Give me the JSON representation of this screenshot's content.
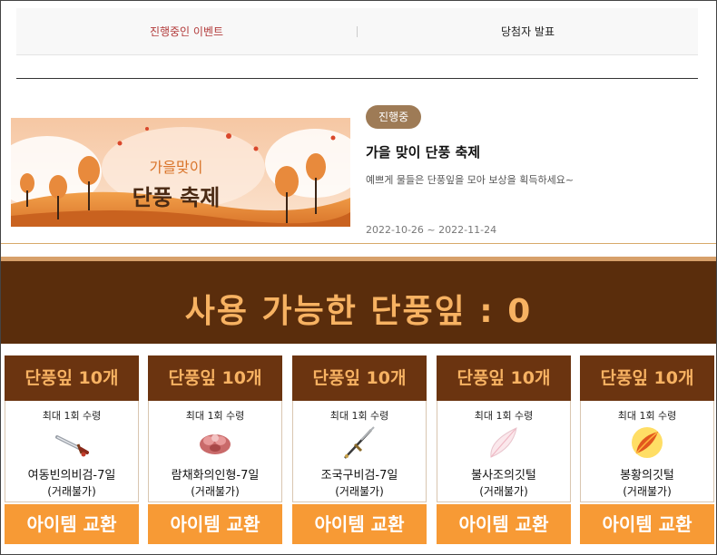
{
  "tabs": [
    {
      "label": "진행중인 이벤트"
    },
    {
      "label": "당첨자 발표"
    }
  ],
  "event": {
    "status": "진행중",
    "title": "가을 맞이 단풍 축제",
    "description": "예쁘게 물들은 단풍잎을 모아 보상을 획득하세요~",
    "period": "2022-10-26 ~ 2022-11-24",
    "banner": {
      "line1": "가을맞이",
      "line2": "단풍 축제"
    }
  },
  "available": {
    "text": "사용 가능한 단풍잎 : 0"
  },
  "cards": [
    {
      "cost": "단풍잎 10개",
      "limit": "최대 1회 수령",
      "name": "여동빈의비검-7일",
      "sub": "(거래불가)",
      "button": "아이템 교환",
      "icon": "sword-icon"
    },
    {
      "cost": "단풍잎 10개",
      "limit": "최대 1회 수령",
      "name": "람채화의인형-7일",
      "sub": "(거래불가)",
      "button": "아이템 교환",
      "icon": "doll-icon"
    },
    {
      "cost": "단풍잎 10개",
      "limit": "최대 1회 수령",
      "name": "조국구비검-7일",
      "sub": "(거래불가)",
      "button": "아이템 교환",
      "icon": "dagger-icon"
    },
    {
      "cost": "단풍잎 10개",
      "limit": "최대 1회 수령",
      "name": "불사조의깃털",
      "sub": "(거래불가)",
      "button": "아이템 교환",
      "icon": "white-feather-icon"
    },
    {
      "cost": "단풍잎 10개",
      "limit": "최대 1회 수령",
      "name": "봉황의깃털",
      "sub": "(거래불가)",
      "button": "아이템 교환",
      "icon": "fire-feather-icon"
    }
  ],
  "colors": {
    "active_tab": "#b23a3a",
    "brown": "#5a2d0c",
    "card_header": "#6b3410",
    "accent_orange": "#f79a35",
    "status_badge": "#9e7b56"
  }
}
